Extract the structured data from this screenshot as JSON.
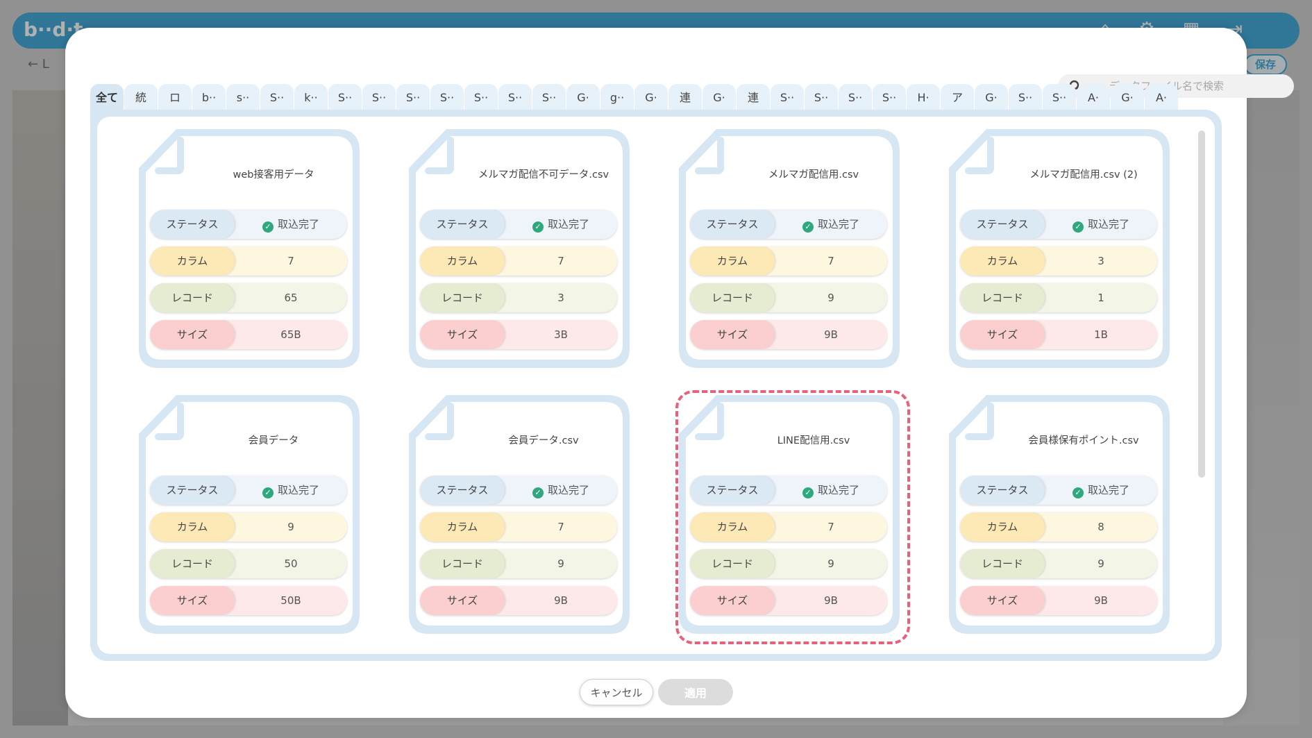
{
  "background_app": {
    "logo": "b··d·t",
    "back_label": "← L",
    "save_label": "保存"
  },
  "modal": {
    "search": {
      "placeholder": "データファイル名で検索"
    },
    "tabs": [
      "全て",
      "統",
      "ロ",
      "b··",
      "s··",
      "S··",
      "k··",
      "S··",
      "S··",
      "S··",
      "S··",
      "S··",
      "S··",
      "S··",
      "G·",
      "g··",
      "G·",
      "連",
      "G·",
      "連",
      "S··",
      "S··",
      "S··",
      "S··",
      "H·",
      "ア",
      "G·",
      "S··",
      "S··",
      "A·",
      "G·",
      "A·"
    ],
    "active_tab": 0,
    "row_labels": {
      "status": "ステータス",
      "columns": "カラム",
      "records": "レコード",
      "size": "サイズ"
    },
    "cards": [
      {
        "title": "web接客用データ",
        "status": "取込完了",
        "columns": "7",
        "records": "65",
        "size": "65B",
        "selected": false
      },
      {
        "title": "メルマガ配信不可データ.csv",
        "status": "取込完了",
        "columns": "7",
        "records": "3",
        "size": "3B",
        "selected": false
      },
      {
        "title": "メルマガ配信用.csv",
        "status": "取込完了",
        "columns": "7",
        "records": "9",
        "size": "9B",
        "selected": false
      },
      {
        "title": "メルマガ配信用.csv (2)",
        "status": "取込完了",
        "columns": "3",
        "records": "1",
        "size": "1B",
        "selected": false
      },
      {
        "title": "会員データ",
        "status": "取込完了",
        "columns": "9",
        "records": "50",
        "size": "50B",
        "selected": false
      },
      {
        "title": "会員データ.csv",
        "status": "取込完了",
        "columns": "7",
        "records": "9",
        "size": "9B",
        "selected": false
      },
      {
        "title": "LINE配信用.csv",
        "status": "取込完了",
        "columns": "7",
        "records": "9",
        "size": "9B",
        "selected": true
      },
      {
        "title": "会員様保有ポイント.csv",
        "status": "取込完了",
        "columns": "8",
        "records": "9",
        "size": "9B",
        "selected": false
      }
    ],
    "buttons": {
      "cancel": "キャンセル",
      "apply": "適用"
    }
  },
  "colors": {
    "accent": "#1f9ad2",
    "status_ok": "#2ea87c",
    "selection": "#e8607a"
  }
}
